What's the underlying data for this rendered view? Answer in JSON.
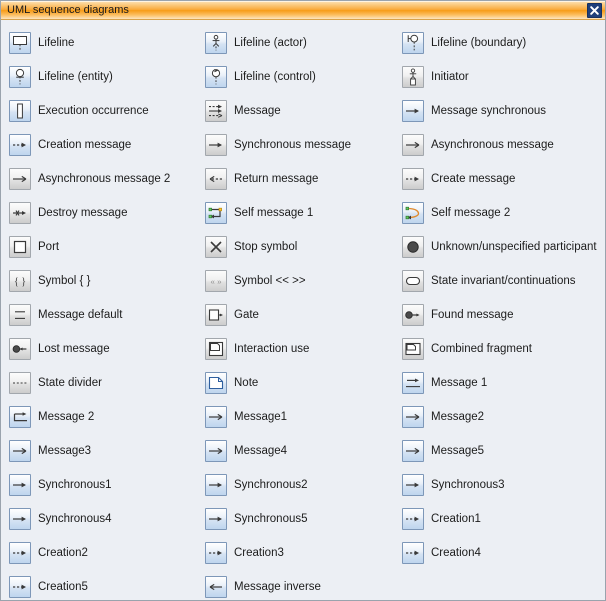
{
  "window": {
    "title": "UML sequence diagrams",
    "close_label": "×",
    "close_icon": "close-icon",
    "accent_color": "#f79b16",
    "titlebar_text_color": "#1a1a1a",
    "body_background": "#eceff4",
    "close_button_color": "#1f3f7a"
  },
  "items": [
    {
      "label": "Lifeline",
      "icon": "lifeline-icon",
      "tile": "blue"
    },
    {
      "label": "Lifeline (actor)",
      "icon": "lifeline-actor-icon",
      "tile": "blue"
    },
    {
      "label": "Lifeline (boundary)",
      "icon": "lifeline-boundary-icon",
      "tile": "blue"
    },
    {
      "label": "Lifeline (entity)",
      "icon": "lifeline-entity-icon",
      "tile": "blue"
    },
    {
      "label": "Lifeline (control)",
      "icon": "lifeline-control-icon",
      "tile": "blue"
    },
    {
      "label": "Initiator",
      "icon": "initiator-icon",
      "tile": "gray"
    },
    {
      "label": "Execution occurrence",
      "icon": "execution-occurrence-icon",
      "tile": "blue"
    },
    {
      "label": "Message",
      "icon": "message-icon",
      "tile": "gray"
    },
    {
      "label": "Message synchronous",
      "icon": "message-synchronous-icon",
      "tile": "blue"
    },
    {
      "label": "Creation message",
      "icon": "creation-message-icon",
      "tile": "blue"
    },
    {
      "label": "Synchronous message",
      "icon": "synchronous-message-icon",
      "tile": "gray"
    },
    {
      "label": "Asynchronous message",
      "icon": "asynchronous-message-icon",
      "tile": "gray"
    },
    {
      "label": "Asynchronous message 2",
      "icon": "asynchronous-message-2-icon",
      "tile": "gray"
    },
    {
      "label": "Return message",
      "icon": "return-message-icon",
      "tile": "gray"
    },
    {
      "label": "Create message",
      "icon": "create-message-icon",
      "tile": "gray"
    },
    {
      "label": "Destroy message",
      "icon": "destroy-message-icon",
      "tile": "gray"
    },
    {
      "label": "Self message 1",
      "icon": "self-message-1-icon",
      "tile": "blue"
    },
    {
      "label": "Self message 2",
      "icon": "self-message-2-icon",
      "tile": "blue"
    },
    {
      "label": "Port",
      "icon": "port-icon",
      "tile": "gray"
    },
    {
      "label": "Stop symbol",
      "icon": "stop-symbol-icon",
      "tile": "gray"
    },
    {
      "label": "Unknown/unspecified participant",
      "icon": "unknown-participant-icon",
      "tile": "gray"
    },
    {
      "label": "Symbol { }",
      "icon": "symbol-braces-icon",
      "tile": "gray"
    },
    {
      "label": "Symbol << >>",
      "icon": "symbol-guillemets-icon",
      "tile": "gray"
    },
    {
      "label": "State invariant/continuations",
      "icon": "state-invariant-icon",
      "tile": "gray"
    },
    {
      "label": "Message default",
      "icon": "message-default-icon",
      "tile": "gray"
    },
    {
      "label": "Gate",
      "icon": "gate-icon",
      "tile": "gray"
    },
    {
      "label": "Found message",
      "icon": "found-message-icon",
      "tile": "gray"
    },
    {
      "label": "Lost message",
      "icon": "lost-message-icon",
      "tile": "gray"
    },
    {
      "label": "Interaction use",
      "icon": "interaction-use-icon",
      "tile": "gray"
    },
    {
      "label": "Combined fragment",
      "icon": "combined-fragment-icon",
      "tile": "gray"
    },
    {
      "label": "State divider",
      "icon": "state-divider-icon",
      "tile": "gray"
    },
    {
      "label": "Note",
      "icon": "note-icon",
      "tile": "blue"
    },
    {
      "label": "Message 1",
      "icon": "message-1-icon",
      "tile": "blue"
    },
    {
      "label": "Message 2",
      "icon": "message-2-icon",
      "tile": "blue"
    },
    {
      "label": "Message1",
      "icon": "message1-icon",
      "tile": "blue"
    },
    {
      "label": "Message2",
      "icon": "message2-icon",
      "tile": "blue"
    },
    {
      "label": "Message3",
      "icon": "message3-icon",
      "tile": "blue"
    },
    {
      "label": "Message4",
      "icon": "message4-icon",
      "tile": "blue"
    },
    {
      "label": "Message5",
      "icon": "message5-icon",
      "tile": "blue"
    },
    {
      "label": "Synchronous1",
      "icon": "synchronous1-icon",
      "tile": "blue"
    },
    {
      "label": "Synchronous2",
      "icon": "synchronous2-icon",
      "tile": "blue"
    },
    {
      "label": "Synchronous3",
      "icon": "synchronous3-icon",
      "tile": "blue"
    },
    {
      "label": "Synchronous4",
      "icon": "synchronous4-icon",
      "tile": "blue"
    },
    {
      "label": "Synchronous5",
      "icon": "synchronous5-icon",
      "tile": "blue"
    },
    {
      "label": "Creation1",
      "icon": "creation1-icon",
      "tile": "blue"
    },
    {
      "label": "Creation2",
      "icon": "creation2-icon",
      "tile": "blue"
    },
    {
      "label": "Creation3",
      "icon": "creation3-icon",
      "tile": "blue"
    },
    {
      "label": "Creation4",
      "icon": "creation4-icon",
      "tile": "blue"
    },
    {
      "label": "Creation5",
      "icon": "creation5-icon",
      "tile": "blue"
    },
    {
      "label": "Message inverse",
      "icon": "message-inverse-icon",
      "tile": "blue"
    }
  ]
}
